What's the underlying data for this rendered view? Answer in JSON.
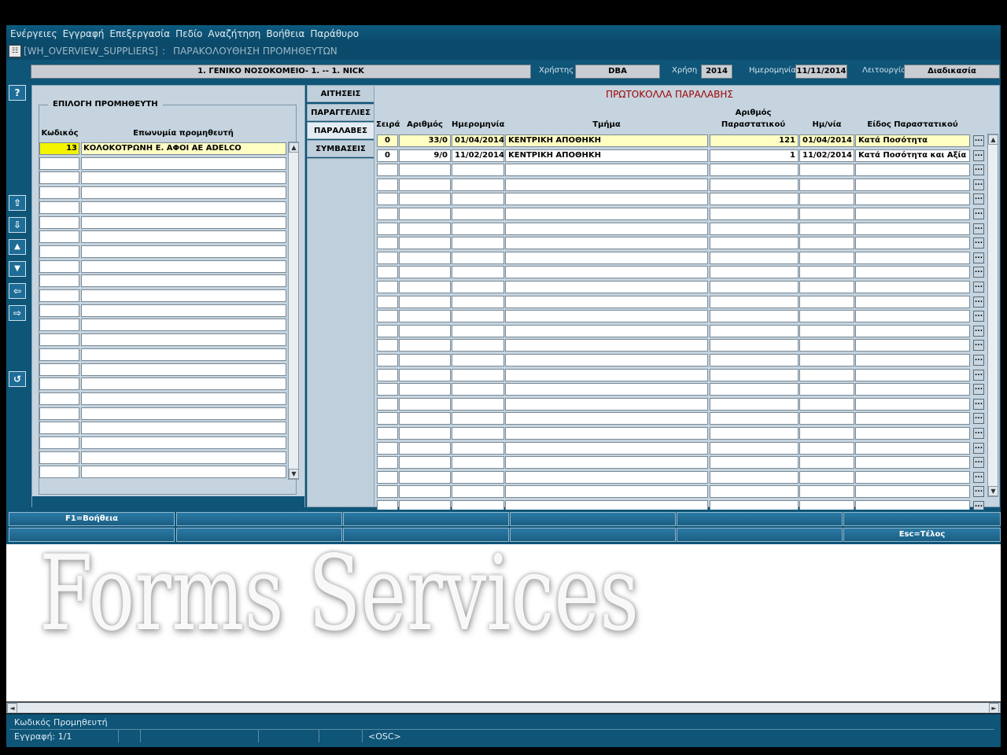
{
  "menu": [
    "Ενέργειες",
    "Εγγραφή",
    "Επεξεργασία",
    "Πεδίο",
    "Αναζήτηση",
    "Βοήθεια",
    "Παράθυρο"
  ],
  "window": {
    "form_name": "[WH_OVERVIEW_SUPPLIERS]",
    "separator": ":",
    "title": "ΠΑΡΑΚΟΛΟΥΘΗΣΗ ΠΡΟΜΗΘΕΥΤΩΝ"
  },
  "header": {
    "org": "1. ΓΕΝΙΚΟ ΝΟΣΟΚΟΜΕΙΟ- 1. -- 1. NICK",
    "user_label": "Χρήστης",
    "user": "DBA",
    "year_label": "Χρήση",
    "year": "2014",
    "date_label": "Ημερομηνία",
    "date": "11/11/2014",
    "function_label": "Λειτουργία",
    "function": "Διαδικασία"
  },
  "side_buttons": {
    "help": "?",
    "up_first": "⇧",
    "down_last": "⇩",
    "up": "▲",
    "down": "▼",
    "left": "⇦",
    "right": "⇨",
    "back": "↺"
  },
  "supplier_panel": {
    "title": "ΕΠΙΛΟΓΗ ΠΡΟΜΗΘΕΥΤΗ",
    "col_code": "Κωδικός",
    "col_name": "Επωνυμία προμηθευτή",
    "rows": [
      {
        "code": "13",
        "name": "ΚΟΛΟΚΟΤΡΩΝΗ Ε. ΑΦΟΙ ΑΕ ADELCO"
      }
    ],
    "scroll_up": "▲",
    "scroll_down": "▼"
  },
  "tabs": [
    "ΑΙΤΗΣΕΙΣ",
    "ΠΑΡΑΓΓΕΛΙΕΣ",
    "ΠΑΡΑΛΑΒΕΣ",
    "ΣΥΜΒΑΣΕΙΣ"
  ],
  "active_tab": "ΠΑΡΑΛΑΒΕΣ",
  "receipts": {
    "title": "ΠΡΩΤΟΚΟΛΛΑ ΠΑΡΑΛΑΒΗΣ",
    "headers": {
      "series": "Σειρά",
      "number": "Αριθμός",
      "date": "Ημερομηνία",
      "dept": "Τμήμα",
      "doc_no_1": "Αριθμός",
      "doc_no_2": "Παραστατικού",
      "doc_date": "Ημ/νία",
      "doc_type": "Είδος Παραστατικού"
    },
    "rows": [
      {
        "series": "0",
        "number": "33/0",
        "date": "01/04/2014",
        "dept": "ΚΕΝΤΡΙΚΗ ΑΠΟΘΗΚΗ",
        "doc_no": "121",
        "doc_date": "01/04/2014",
        "doc_type": "Κατά Ποσότητα"
      },
      {
        "series": "0",
        "number": "9/0",
        "date": "11/02/2014",
        "dept": "ΚΕΝΤΡΙΚΗ ΑΠΟΘΗΚΗ",
        "doc_no": "1",
        "doc_date": "11/02/2014",
        "doc_type": "Κατά Ποσότητα και Αξία"
      }
    ],
    "dots": "...",
    "scroll_up": "▲",
    "scroll_down": "▼"
  },
  "function_keys": {
    "row1": [
      "F1=Βοήθεια",
      "",
      "",
      "",
      "",
      ""
    ],
    "row2": [
      "",
      "",
      "",
      "",
      "",
      "Esc=Τέλος"
    ]
  },
  "watermark": "Forms Services",
  "status": {
    "message": "Κωδικός Προμηθευτή",
    "record": "Εγγραφή: 1/1",
    "osc": "<OSC>"
  },
  "hscroll": {
    "left": "◄",
    "right": "►"
  },
  "colors": {
    "panel": "#0e5578",
    "selected_cell": "#ffffc4",
    "key_cell": "#f4f400",
    "title_red": "#a00000"
  }
}
